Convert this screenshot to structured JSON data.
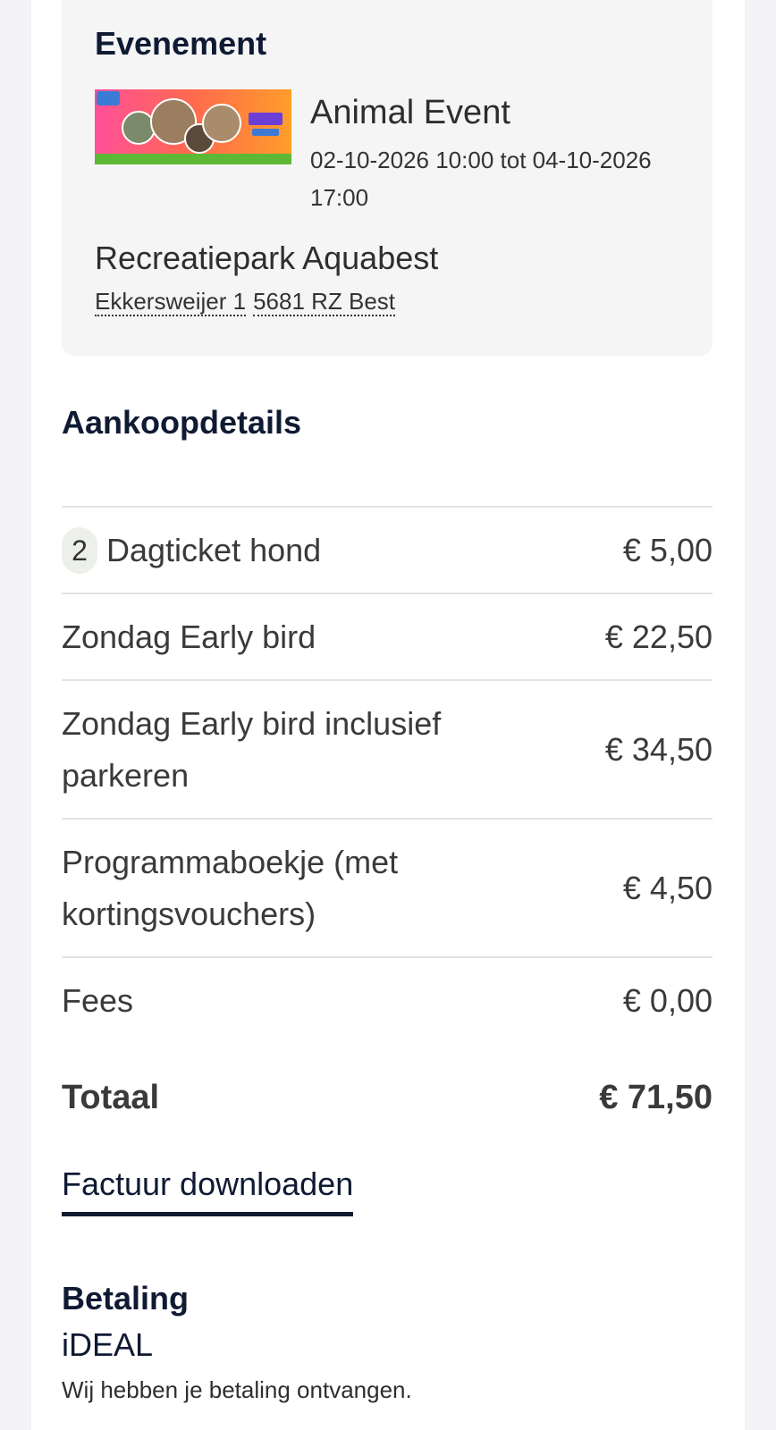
{
  "event": {
    "heading": "Evenement",
    "image_alt": "Animal Event banner",
    "name": "Animal Event",
    "dates": "02-10-2026 10:00 tot 04-10-2026 17:00",
    "venue": "Recreatiepark Aquabest",
    "address_street": "Ekkersweijer 1",
    "address_city": "5681 RZ Best"
  },
  "purchase": {
    "title": "Aankoopdetails",
    "items": [
      {
        "qty": "2",
        "label": "Dagticket hond",
        "price": "€ 5,00"
      },
      {
        "label": "Zondag Early bird",
        "price": "€ 22,50"
      },
      {
        "label": "Zondag Early bird inclusief parkeren",
        "price": "€ 34,50"
      },
      {
        "label": "Programmaboekje (met kortingsvouchers)",
        "price": "€ 4,50"
      },
      {
        "label": "Fees",
        "price": "€ 0,00"
      }
    ],
    "total_label": "Totaal",
    "total_value": "€ 71,50",
    "download_label": "Factuur downloaden"
  },
  "payment": {
    "title": "Betaling",
    "method": "iDEAL",
    "status": "Wij hebben je betaling ontvangen."
  }
}
